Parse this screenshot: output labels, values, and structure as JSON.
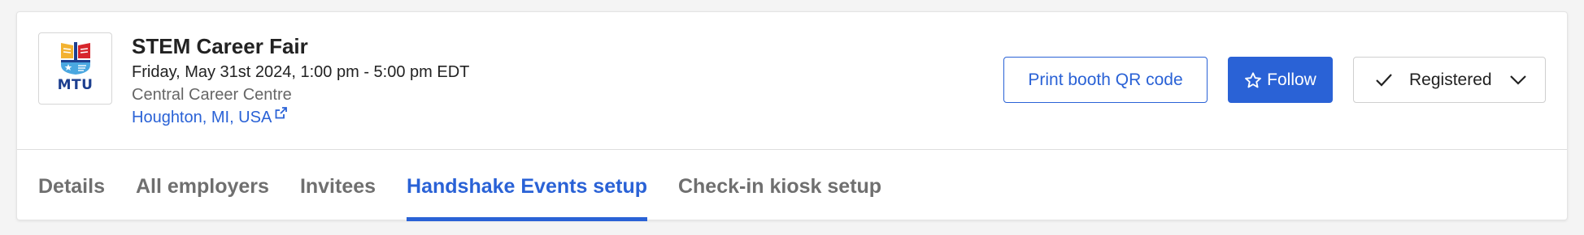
{
  "event": {
    "logo_text": "MTU",
    "title": "STEM Career Fair",
    "date": "Friday, May 31st 2024, 1:00 pm - 5:00 pm EDT",
    "venue": "Central Career Centre",
    "location": "Houghton, MI, USA"
  },
  "actions": {
    "print_qr_label": "Print booth QR code",
    "follow_label": "Follow",
    "registered_label": "Registered"
  },
  "tabs": [
    {
      "label": "Details",
      "active": false
    },
    {
      "label": "All employers",
      "active": false
    },
    {
      "label": "Invitees",
      "active": false
    },
    {
      "label": "Handshake Events setup",
      "active": true
    },
    {
      "label": "Check-in kiosk setup",
      "active": false
    }
  ],
  "icons": {
    "logo": "mtu-logo",
    "location_link": "external-link-icon",
    "follow": "star-icon",
    "registered_check": "check-icon",
    "registered_dropdown": "chevron-down-icon"
  },
  "colors": {
    "accent": "#2a62d6",
    "tab_inactive": "#6f6f6f",
    "text": "#222222",
    "muted": "#666666",
    "logo_blue": "#1d3f8f",
    "logo_red": "#d7262c",
    "logo_yellow": "#f3b230",
    "logo_light_blue": "#4aa7e0"
  }
}
